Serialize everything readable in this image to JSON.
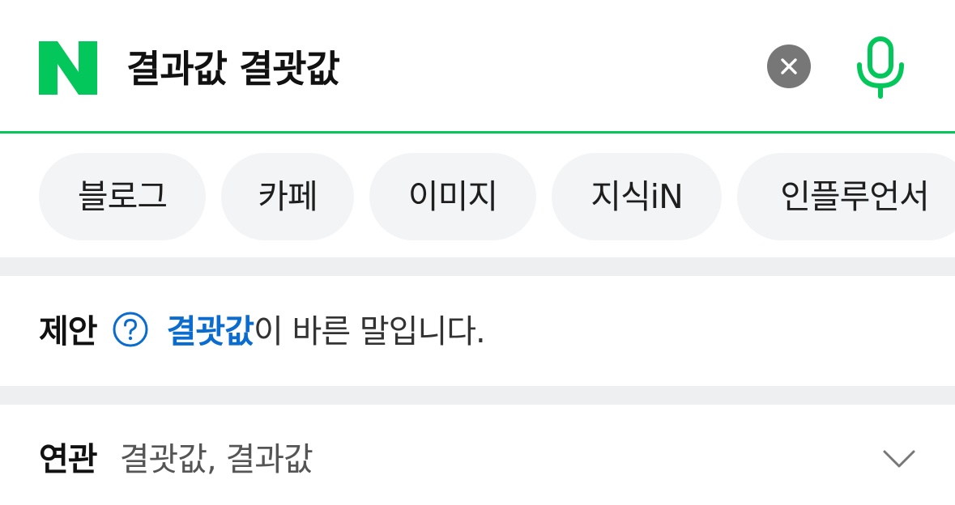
{
  "search": {
    "logo_letter": "N",
    "query": "결과값 결괏값",
    "brand_color": "#03c75a",
    "clear_icon": "close-icon",
    "mic_icon": "microphone-icon"
  },
  "tabs": [
    {
      "label": "블로그"
    },
    {
      "label": "카페"
    },
    {
      "label": "이미지"
    },
    {
      "label": "지식iN"
    },
    {
      "label": "인플루언서"
    }
  ],
  "suggestion": {
    "label": "제안",
    "help_icon": "question-circle-icon",
    "word": "결괏값",
    "rest": "이 바른 말입니다.",
    "word_color": "#0a6ccf"
  },
  "related": {
    "label": "연관",
    "terms": "결괏값, 결과값",
    "expand_icon": "chevron-down-icon"
  }
}
